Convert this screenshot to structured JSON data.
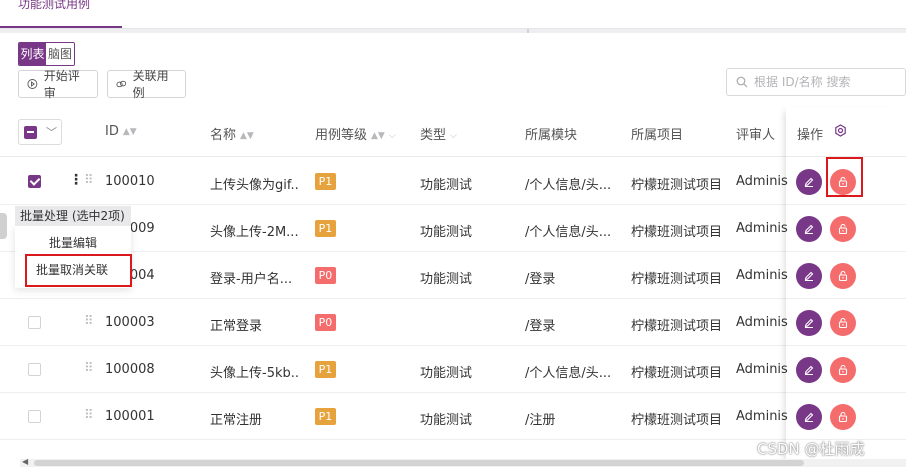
{
  "top_tab": "功能测试用例",
  "view_switch": {
    "list": "列表",
    "mind": "脑图"
  },
  "toolbar": {
    "start_review": "开始评审",
    "link_cases": "关联用例"
  },
  "search": {
    "placeholder": "根据 ID/名称 搜索"
  },
  "columns": {
    "id": "ID",
    "name": "名称",
    "level": "用例等级",
    "type": "类型",
    "module": "所属模块",
    "project": "所属项目",
    "reviewer": "评审人",
    "ops": "操作"
  },
  "rows": [
    {
      "id": "100010",
      "name": "上传头像为gif...",
      "level": "P1",
      "type": "功能测试",
      "module": "/个人信息/头...",
      "project": "柠檬班测试项目",
      "reviewer": "Administ",
      "checked": true
    },
    {
      "id": "100009",
      "name": "头像上传-2M...",
      "level": "P1",
      "type": "功能测试",
      "module": "/个人信息/头...",
      "project": "柠檬班测试项目",
      "reviewer": "Administ",
      "checked": true
    },
    {
      "id": "100004",
      "name": "登录-用户名...",
      "level": "P0",
      "type": "功能测试",
      "module": "/登录",
      "project": "柠檬班测试项目",
      "reviewer": "Administ",
      "checked": false
    },
    {
      "id": "100003",
      "name": "正常登录",
      "level": "P0",
      "type": "",
      "module": "/登录",
      "project": "柠檬班测试项目",
      "reviewer": "Administ",
      "checked": false
    },
    {
      "id": "100008",
      "name": "头像上传-5kb...",
      "level": "P1",
      "type": "功能测试",
      "module": "/个人信息/头...",
      "project": "柠檬班测试项目",
      "reviewer": "Administ",
      "checked": false
    },
    {
      "id": "100001",
      "name": "正常注册",
      "level": "P1",
      "type": "功能测试",
      "module": "/注册",
      "project": "柠檬班测试项目",
      "reviewer": "Administ",
      "checked": false
    }
  ],
  "batch": {
    "title": "批量处理 (选中2项)",
    "edit": "批量编辑",
    "unlink": "批量取消关联"
  },
  "watermark": "CSDN @杜雨成",
  "colors": {
    "accent": "#783887",
    "danger": "#f56c6c",
    "warning": "#e6a23c",
    "highlight": "#d9191c"
  }
}
